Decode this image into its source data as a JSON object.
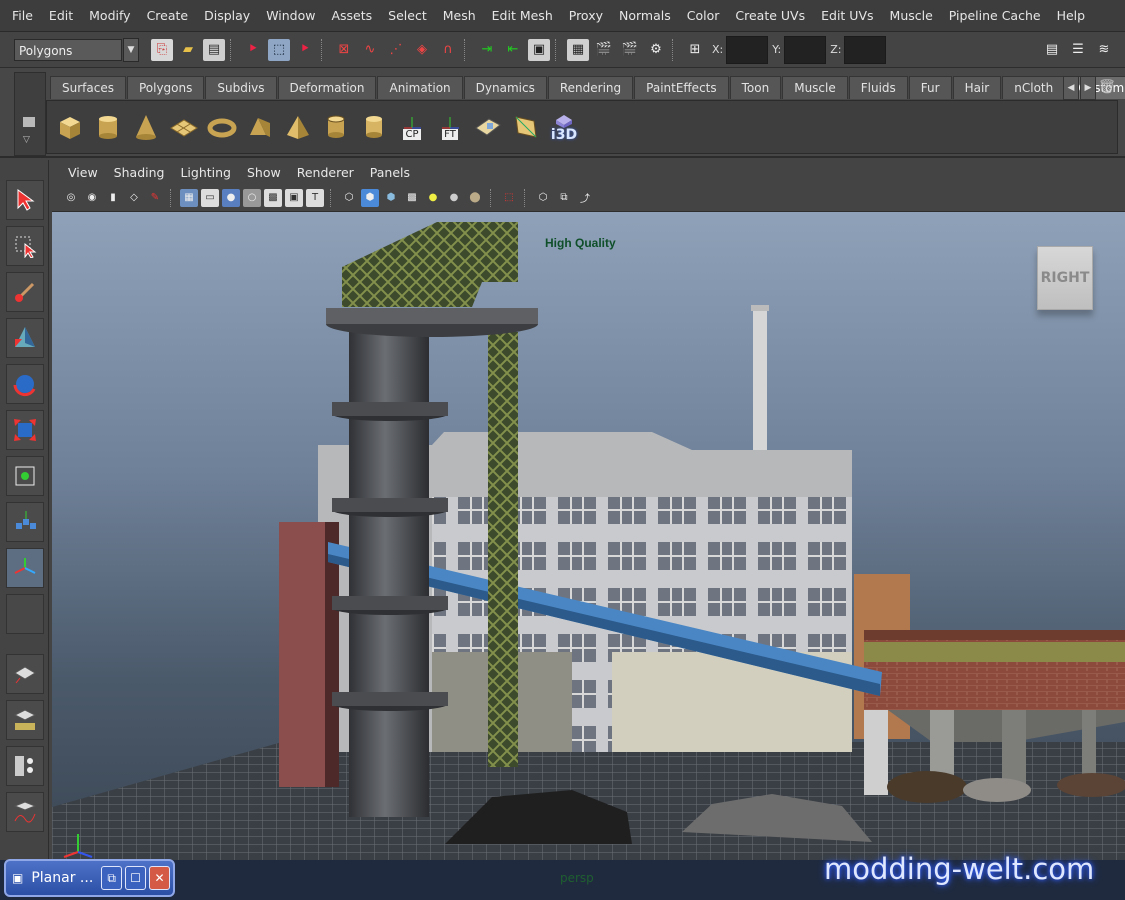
{
  "menubar": {
    "items": [
      "File",
      "Edit",
      "Modify",
      "Create",
      "Display",
      "Window",
      "Assets",
      "Select",
      "Mesh",
      "Edit Mesh",
      "Proxy",
      "Normals",
      "Color",
      "Create UVs",
      "Edit UVs",
      "Muscle",
      "Pipeline Cache",
      "Help"
    ]
  },
  "statusline": {
    "mode": "Polygons",
    "coord_labels": [
      "X:",
      "Y:",
      "Z:"
    ]
  },
  "shelf": {
    "tabs": [
      "Surfaces",
      "Polygons",
      "Subdivs",
      "Deformation",
      "Animation",
      "Dynamics",
      "Rendering",
      "PaintEffects",
      "Toon",
      "Muscle",
      "Fluids",
      "Fur",
      "Hair",
      "nCloth",
      "Custom"
    ],
    "active_tab": "Custom",
    "labeled_icons": [
      "CP",
      "FT",
      "i3D"
    ]
  },
  "panel": {
    "menus": [
      "View",
      "Shading",
      "Lighting",
      "Show",
      "Renderer",
      "Panels"
    ]
  },
  "viewport": {
    "quality_label": "High Quality",
    "view_cube_label": "RIGHT",
    "camera_label": "persp"
  },
  "window": {
    "minimized_title": "Planar ..."
  },
  "watermark": "modding-welt.com",
  "colors": {
    "menubar_bg": "#3d3d3d",
    "viewport_top": "#8fa1b8",
    "viewport_bottom": "#3b4653",
    "quality_text": "#0f4f2a",
    "conveyor": "#4a86c4",
    "watermark_glow": "#2f5cff"
  }
}
